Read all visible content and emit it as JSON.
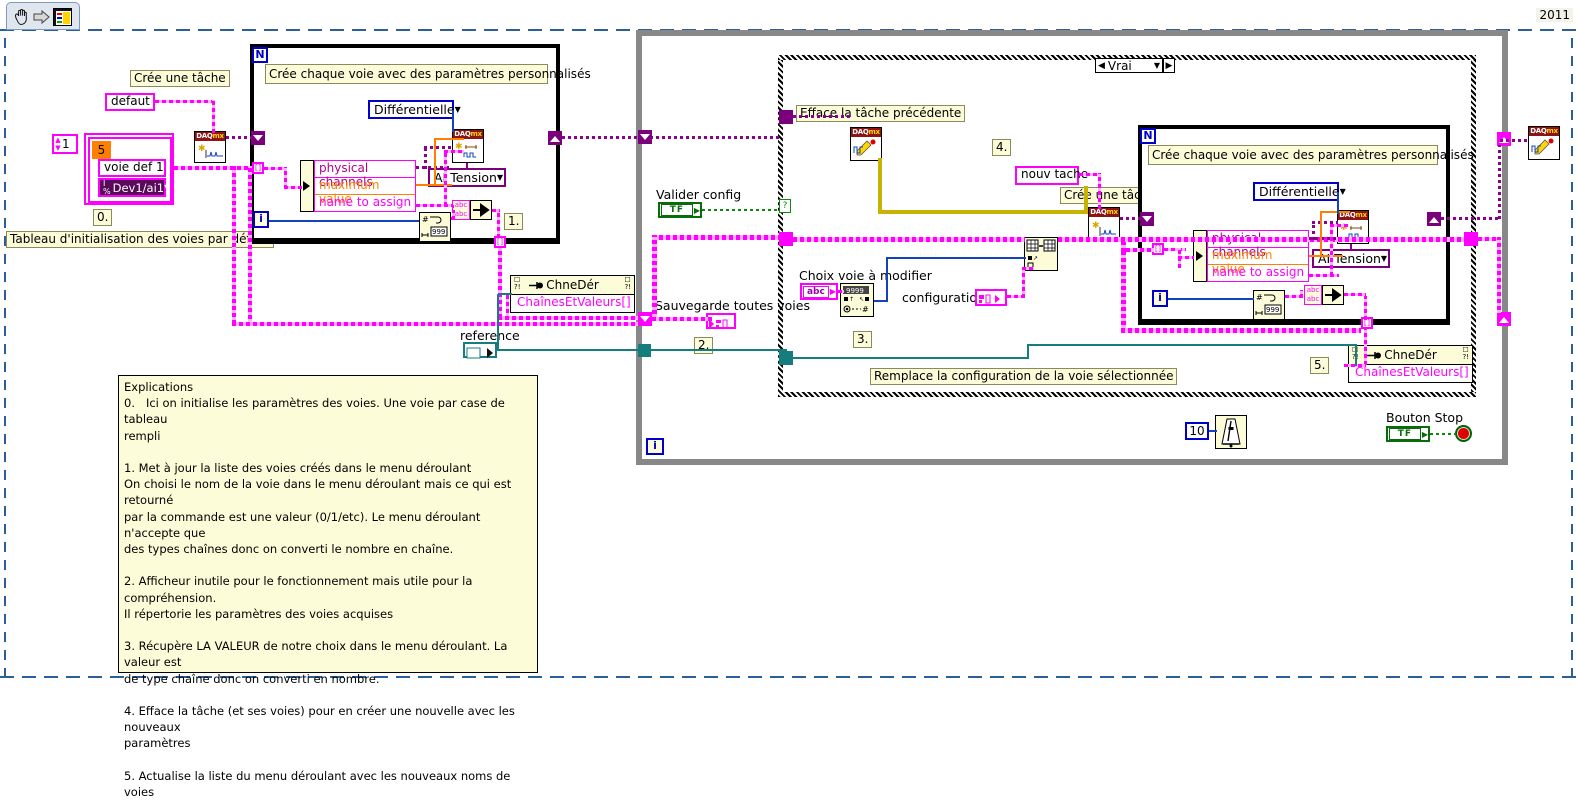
{
  "window": {
    "version_label": "2011",
    "toolbar_icons": [
      "hand-icon",
      "arrow-icon",
      "diagram-icon"
    ]
  },
  "left_section": {
    "create_task_label": "Crée une tâche",
    "default_string": "defaut",
    "array_size": "1",
    "array_index": "5",
    "channel_name": "voie def 1",
    "device_channel": "Dev1/ai1",
    "step_marker": "0.",
    "array_caption": "Tableau d'initialisation des voies par défaut"
  },
  "loop1": {
    "n_terminal": "N",
    "i_terminal": "i",
    "title": "Crée chaque voie avec des paramètres personnalisés",
    "terminal_mode": "Différentielle",
    "measure_type": "AI Tension",
    "cluster_items": [
      "physical channels",
      "maximum value",
      "name to assign"
    ],
    "step_marker": "1.",
    "daq_node": "daqmx-create-channel-icon",
    "number_to_string_node": "number-to-decimal-string-icon",
    "concat_node": "concatenate-strings-icon"
  },
  "middle": {
    "chnedér_label": "ChneDér",
    "chnedér_type": "ChaînesEtValeurs[]",
    "reference_label": "reference",
    "valider_config_label": "Valider config",
    "valider_config_value": "TF",
    "sauvegarde_label": "Sauvegarde toutes voies",
    "step_marker": "2."
  },
  "case_structure": {
    "selector_value": "Vrai",
    "efface_label": "Efface la tâche précédente",
    "step4_marker": "4.",
    "nouv_tache_label": "nouv tache",
    "cree_tache_label": "Crée une tâche",
    "choix_label": "Choix voie à modifier",
    "choix_value": "abc",
    "configuration_label": "configuration",
    "step3_marker": "3.",
    "remplace_label": "Remplace la configuration de la voie sélectionnée",
    "step5_marker": "5.",
    "daq_clear_node": "daqmx-clear-task-icon",
    "daq_create_node": "daqmx-create-task-icon",
    "string_to_number_node": "string-to-number-icon",
    "replace_array_node": "replace-array-subset-icon"
  },
  "loop2": {
    "n_terminal": "N",
    "i_terminal": "i",
    "title": "Crée chaque voie avec des paramètres personnalisés",
    "terminal_mode": "Différentielle",
    "measure_type": "AI Tension",
    "cluster_items": [
      "physical channels",
      "maximum value",
      "name to assign"
    ],
    "chnedér_label": "ChneDér",
    "chnedér_type": "ChaînesEtValeurs[]"
  },
  "bottom": {
    "wait_value": "10",
    "metronome_icon": "wait-ms-metronome-icon",
    "stop_label": "Bouton Stop",
    "stop_value": "TF",
    "while_i_terminal": "i"
  },
  "right": {
    "daq_clear_node": "daqmx-clear-task-icon"
  },
  "explanations": {
    "title": "Explications",
    "body": "0.   Ici on initialise les paramètres des voies. Une voie par case de tableau\nrempli\n\n1. Met à jour la liste des voies créés dans le menu déroulant\nOn choisi le nom de la voie dans le menu déroulant mais ce qui est retourné\npar la commande est une valeur (0/1/etc). Le menu déroulant n'accepte que\ndes types chaînes donc on converti le nombre en chaîne.\n\n2. Afficheur inutile pour le fonctionnement mais utile pour la compréhension.\nIl répertorie les paramètres des voies acquises\n\n3. Récupère LA VALEUR de notre choix dans le menu déroulant. La valeur est\nde type chaîne donc on converti en nombre.\n\n4. Efface la tâche (et ses voies) pour en créer une nouvelle avec les nouveaux\nparamètres\n\n5. Actualise la liste du menu déroulant avec les nouveaux noms de voies"
  },
  "colors": {
    "string_wire": "#ff00ff",
    "task_wire": "#8d008d",
    "error_wire": "#c8b400",
    "boolean_wire": "#008000",
    "refnum_wire": "#157d7d",
    "numeric_wire": "#1144bb",
    "label_bg": "#fdfcd8"
  }
}
